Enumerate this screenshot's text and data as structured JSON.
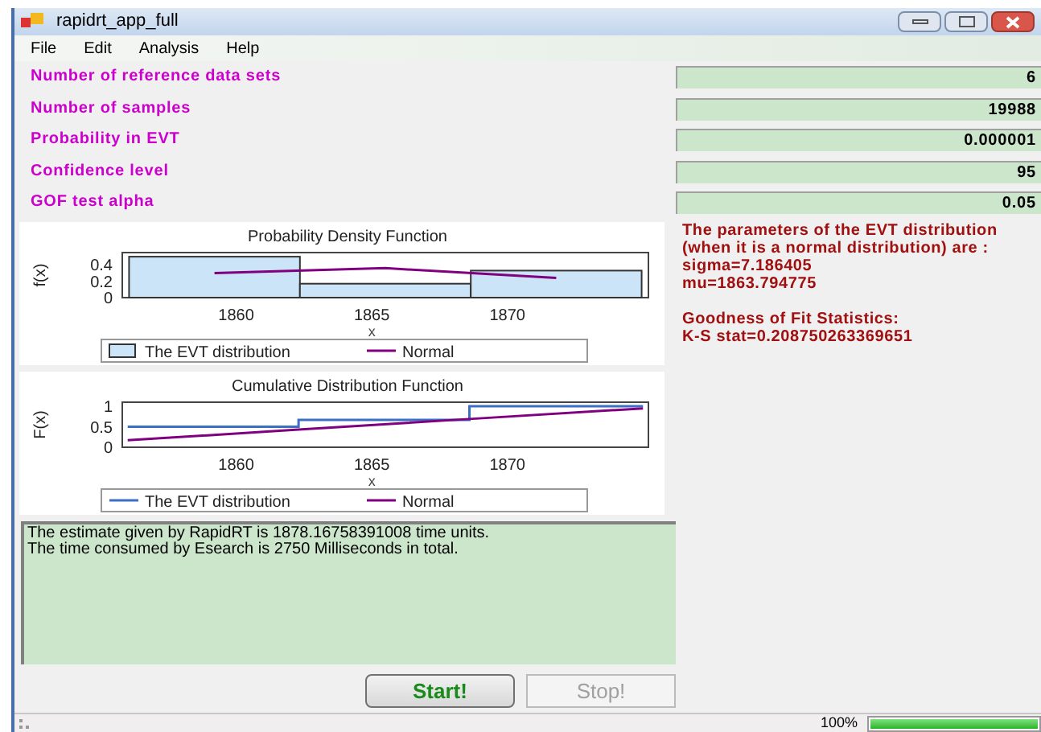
{
  "window": {
    "title": "rapidrt_app_full"
  },
  "menu": [
    "File",
    "Edit",
    "Analysis",
    "Help"
  ],
  "parameters": [
    {
      "label": "Number of reference data sets",
      "value": "6"
    },
    {
      "label": "Number of samples",
      "value": "19988"
    },
    {
      "label": "Probability in EVT",
      "value": "0.000001"
    },
    {
      "label": "Confidence level",
      "value": "95"
    },
    {
      "label": "GOF test alpha",
      "value": "0.05"
    }
  ],
  "charts": [
    {
      "chart_data": {
        "type": "bar",
        "title": "Probability Density Function",
        "xlabel": "x",
        "ylabel": "f(x)",
        "x": [
          1859.2,
          1865.5,
          1871.8
        ],
        "xlim": [
          1855.8,
          1875.2
        ],
        "ylim": [
          0,
          0.55
        ],
        "xticks": [
          1860,
          1865,
          1870
        ],
        "yticks": [
          0,
          0.2,
          0.4
        ],
        "legend": true,
        "series": [
          {
            "name": "The EVT distribution",
            "color": "#cce4f7",
            "values": [
              0.5,
              0.17,
              0.33
            ]
          },
          {
            "name": "Normal",
            "type": "line",
            "color": "#800080",
            "values": [
              0.3,
              0.36,
              0.24
            ]
          }
        ]
      }
    },
    {
      "chart_data": {
        "type": "line",
        "title": "Cumulative Distribution Function",
        "xlabel": "x",
        "ylabel": "F(x)",
        "x": [
          1856,
          1862.3,
          1862.3,
          1868.6,
          1868.6,
          1875
        ],
        "xlim": [
          1855.8,
          1875.2
        ],
        "ylim": [
          0,
          1.1
        ],
        "xticks": [
          1860,
          1865,
          1870
        ],
        "yticks": [
          0,
          0.5,
          1
        ],
        "legend": true,
        "series": [
          {
            "name": "The EVT distribution",
            "color": "#3a6fc4",
            "values": [
              0.5,
              0.5,
              0.67,
              0.67,
              1.0,
              1.0
            ]
          },
          {
            "name": "Normal",
            "color": "#800080",
            "values": [
              0.17,
              0.43,
              0.43,
              0.69,
              0.69,
              0.95
            ]
          }
        ]
      }
    }
  ],
  "results": [
    [
      "The parameters of the EVT distribution (when it is a normal distribution) are :",
      "sigma=7.186405",
      "mu=1863.794775"
    ],
    [
      "Goodness of Fit Statistics:",
      "K-S stat=0.208750263369651"
    ]
  ],
  "log": [
    "The estimate given by RapidRT is 1878.16758391008 time units.",
    "The time consumed by Esearch is 2750 Milliseconds in total."
  ],
  "buttons": [
    {
      "label": "Start!",
      "disabled": false
    },
    {
      "label": "Stop!",
      "disabled": true
    }
  ],
  "status_bar": {
    "percent": "100%",
    "level": 1
  }
}
